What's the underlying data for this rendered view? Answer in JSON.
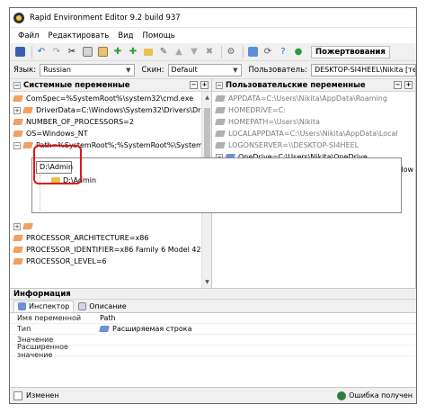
{
  "app": {
    "title": "Rapid Environment Editor 9.2 build 937"
  },
  "menu": [
    "Файл",
    "Редактировать",
    "Вид",
    "Помощь"
  ],
  "toolbar": {
    "donate_label": "Пожертвования"
  },
  "options": {
    "language_label": "Язык:",
    "language_value": "Russian",
    "skin_label": "Скин:",
    "skin_value": "Default",
    "user_label": "Пользователь:",
    "user_value": "DESKTOP-SI4HEEL\\Nikita [текущ"
  },
  "system_panel": {
    "title": "Системные переменные",
    "rows": [
      "ComSpec=%SystemRoot%\\system32\\cmd.exe",
      "DriverData=C:\\Windows\\System32\\Drivers\\DriverData",
      "NUMBER_OF_PROCESSORS=2",
      "OS=Windows_NT",
      "Path=%SystemRoot%;%SystemRoot%\\System32\\Wi"
    ],
    "bottom_rows": [
      "PROCESSOR_ARCHITECTURE=x86",
      "PROCESSOR_IDENTIFIER=x86 Family 6 Model 42 Step",
      "PROCESSOR_LEVEL=6"
    ]
  },
  "user_panel": {
    "title": "Пользовательские переменные",
    "rows": [
      "APPDATA=C:\\Users\\Nikita\\AppData\\Roaming",
      "HOMEDRIVE=C:",
      "HOMEPATH=\\Users\\Nikita",
      "LOCALAPPDATA=C:\\Users\\Nikita\\AppData\\Local",
      "LOGONSERVER=\\\\DESKTOP-SI4HEEL"
    ],
    "onedrive_row": "OneDrive=C:\\Users\\Nikita\\OneDrive",
    "overflow_text": "dow"
  },
  "editor": {
    "input_value": "D:\\Admin",
    "suggestion": "D:\\Admin"
  },
  "info": {
    "title": "Информация",
    "tabs": [
      "Инспектор",
      "Описание"
    ],
    "properties": [
      {
        "name": "Имя переменной",
        "value": "Path"
      },
      {
        "name": "Тип",
        "value": "Расширяемая строка"
      },
      {
        "name": "Значение",
        "value": ""
      },
      {
        "name": "Расширенное значение",
        "value": ""
      }
    ]
  },
  "status": {
    "left": "Изменен",
    "right": "Ошибка получен"
  },
  "colors": {
    "highlight": "#e01818",
    "accent_orange": "#f0a060",
    "folder": "#e8c24e"
  }
}
